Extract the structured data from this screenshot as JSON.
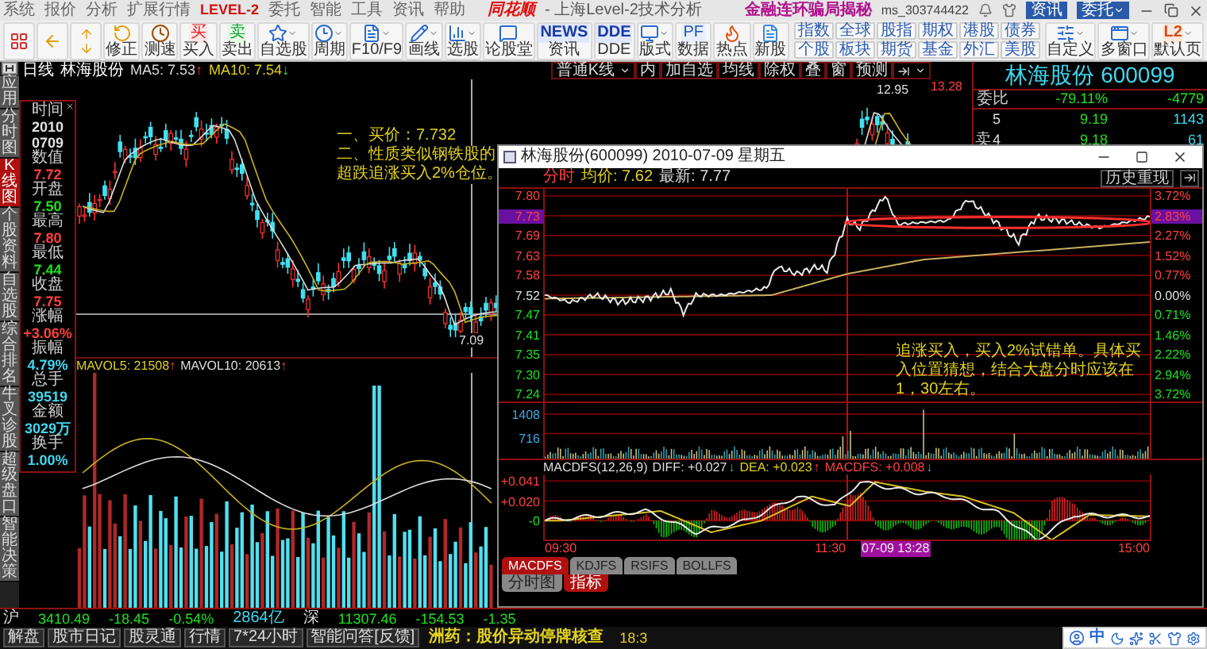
{
  "menu_bar": {
    "items": [
      {
        "label": "系统",
        "highlight": false
      },
      {
        "label": "报价",
        "highlight": false
      },
      {
        "label": "分析",
        "highlight": false
      },
      {
        "label": "扩展行情",
        "highlight": false
      },
      {
        "label": "LEVEL-2",
        "highlight": true
      },
      {
        "label": "委托",
        "highlight": false
      },
      {
        "label": "智能",
        "highlight": false
      },
      {
        "label": "工具",
        "highlight": false
      },
      {
        "label": "资讯",
        "highlight": false
      },
      {
        "label": "帮助",
        "highlight": false
      }
    ],
    "logo": "同花顺",
    "title": "- 上海Level-2技术分析",
    "promo": "金融连环骗局揭秘",
    "user": "ms_303744422",
    "buttons": [
      {
        "label": "资讯",
        "dropdown": false
      },
      {
        "label": "委托",
        "dropdown": true
      }
    ]
  },
  "toolbar": {
    "tools": [
      {
        "dropdown": false
      },
      {
        "dropdown": false
      },
      {
        "dropdown": false
      },
      {
        "label": "修正",
        "dropdown": false
      },
      {
        "label": "测速",
        "dropdown": false
      },
      {
        "label": "买入",
        "icon_text": "买",
        "dropdown": false
      },
      {
        "label": "卖出",
        "icon_text": "卖",
        "dropdown": false
      },
      {
        "label": "自选股",
        "dropdown": true
      },
      {
        "label": "周期",
        "dropdown": true
      },
      {
        "label": "F10/F9",
        "dropdown": true
      },
      {
        "label": "画线",
        "dropdown": true
      },
      {
        "label": "选股",
        "dropdown": true
      },
      {
        "label": "论股堂",
        "dropdown": false
      },
      {
        "label": "资讯",
        "icon_text": "NEWS",
        "dropdown": false
      },
      {
        "label": "DDE",
        "icon_text": "DDE",
        "dropdown": false
      },
      {
        "label": "版式",
        "dropdown": true
      },
      {
        "label": "数据",
        "icon_text": "PF",
        "dropdown": false
      },
      {
        "label": "热点",
        "dropdown": false
      },
      {
        "label": "新股",
        "dropdown": false
      }
    ],
    "market_buttons": [
      {
        "top": "指数",
        "bottom": "个股"
      },
      {
        "top": "全球",
        "bottom": "板块"
      },
      {
        "top": "股指",
        "bottom": "期货"
      },
      {
        "top": "期权",
        "bottom": "基金"
      },
      {
        "top": "港股",
        "bottom": "外汇"
      },
      {
        "top": "债券",
        "bottom": "美股"
      }
    ],
    "tools_right": [
      {
        "label": "自定义",
        "dropdown": true
      },
      {
        "label": "多窗口",
        "dropdown": true
      },
      {
        "label": "默认页",
        "icon_text": "L2",
        "dropdown": true
      }
    ]
  },
  "side_tabs": [
    {
      "label": "应用",
      "selected": false
    },
    {
      "label": "分时图",
      "selected": false
    },
    {
      "label": "K线图",
      "selected": true
    },
    {
      "label": "个股资料",
      "selected": false
    },
    {
      "label": "自选股",
      "selected": false
    },
    {
      "label": "综合排名",
      "selected": false
    },
    {
      "label": "牛叉诊股",
      "selected": false
    },
    {
      "label": "超级盘口",
      "selected": false
    },
    {
      "label": "智能决策",
      "selected": false
    }
  ],
  "kline": {
    "period": "日线",
    "stock": "林海股份",
    "ma5": {
      "label": "MA5: 7.53",
      "arrow": "↑"
    },
    "ma10": {
      "label": "MA10: 7.54",
      "arrow": "↓"
    },
    "low_label": "7.09",
    "high_label": "12.95",
    "max_label": "13.28",
    "annotation": [
      "一、买价：7.732",
      "二、性质类似钢铁股的",
      "超跌追涨买入2%仓位。"
    ]
  },
  "chart_toolbar": [
    {
      "label": "普通K线",
      "dropdown": true
    },
    {
      "label": "内",
      "dropdown": false
    },
    {
      "label": "加自选",
      "dropdown": false
    },
    {
      "label": "均线",
      "dropdown": false
    },
    {
      "label": "除权",
      "dropdown": false
    },
    {
      "label": "叠",
      "dropdown": false
    },
    {
      "label": "窗",
      "dropdown": false
    },
    {
      "label": "预测",
      "dropdown": false
    },
    {
      "dropdown": true
    }
  ],
  "info_box": [
    {
      "label": "时间",
      "values": [
        "2010",
        "0709"
      ],
      "kind": "plain"
    },
    {
      "label": "数值",
      "values": [
        "7.72"
      ],
      "kind": "up"
    },
    {
      "label": "开盘",
      "values": [
        "7.50"
      ],
      "kind": "down"
    },
    {
      "label": "最高",
      "values": [
        "7.80"
      ],
      "kind": "up"
    },
    {
      "label": "最低",
      "values": [
        "7.44"
      ],
      "kind": "down"
    },
    {
      "label": "收盘",
      "values": [
        "7.75"
      ],
      "kind": "up"
    },
    {
      "label": "涨幅",
      "values": [
        "+3.06%"
      ],
      "kind": "up"
    },
    {
      "label": "振幅",
      "values": [
        "4.79%"
      ],
      "kind": "info"
    },
    {
      "label": "总手",
      "values": [
        "39519"
      ],
      "kind": "info"
    },
    {
      "label": "金额",
      "values": [
        "3029万"
      ],
      "kind": "info"
    },
    {
      "label": "换手",
      "values": [
        "1.00%"
      ],
      "kind": "info"
    }
  ],
  "volume": {
    "mavol5": {
      "label": "MAVOL5: 21508",
      "arrow": "↑"
    },
    "mavol10": {
      "label": "MAVOL10: 20613",
      "arrow": "↑"
    }
  },
  "quote_panel": {
    "title": "林海股份 600099",
    "ratio": {
      "label": "委比",
      "percent": "-79.11%",
      "volume": "-4779"
    },
    "side_label": "卖",
    "rows": [
      {
        "rank": "5",
        "price": "9.19",
        "volume": "1143"
      },
      {
        "rank": "4",
        "price": "9.18",
        "volume": "61"
      }
    ]
  },
  "popup": {
    "title": "林海股份(600099) 2010-07-09 星期五",
    "mode": "分时",
    "avg": "均价: 7.62",
    "latest": "最新: 7.77",
    "replay_button": "历史重现",
    "price_scale": [
      {
        "price": "7.80",
        "percent": "3.72%",
        "kind": "up",
        "selected": false
      },
      {
        "price": "7.73",
        "percent": "2.83%",
        "kind": "up",
        "selected": true
      },
      {
        "price": "7.69",
        "percent": "2.27%",
        "kind": "up",
        "selected": false
      },
      {
        "price": "7.63",
        "percent": "1.52%",
        "kind": "up",
        "selected": false
      },
      {
        "price": "7.58",
        "percent": "0.77%",
        "kind": "up",
        "selected": false
      },
      {
        "price": "7.52",
        "percent": "0.00%",
        "kind": "plain",
        "selected": false
      },
      {
        "price": "7.47",
        "percent": "0.71%",
        "kind": "down",
        "selected": false
      },
      {
        "price": "7.41",
        "percent": "1.46%",
        "kind": "down",
        "selected": false
      },
      {
        "price": "7.35",
        "percent": "2.22%",
        "kind": "down",
        "selected": false
      },
      {
        "price": "7.30",
        "percent": "2.94%",
        "kind": "down",
        "selected": false
      },
      {
        "price": "7.24",
        "percent": "3.72%",
        "kind": "down",
        "selected": false
      }
    ],
    "volume_ticks": [
      "1408",
      "716"
    ],
    "macd": {
      "name": "MACDFS(12,26,9)",
      "diff": "DIFF: +0.027",
      "diff_arrow": "↓",
      "dea": "DEA: +0.023",
      "dea_arrow": "↑",
      "value": "MACDFS: +0.008",
      "value_arrow": "↓"
    },
    "macd_ticks": [
      {
        "label": "+0.041",
        "kind": "up"
      },
      {
        "label": "+0.020",
        "kind": "up"
      },
      {
        "label": "-0",
        "kind": "down"
      }
    ],
    "time_labels": [
      {
        "label": "09:30",
        "selected": false
      },
      {
        "label": "11:30",
        "selected": false
      },
      {
        "label": "07-09 13:28",
        "selected": true
      },
      {
        "label": "15:00",
        "selected": false
      }
    ],
    "annotation": "追涨买入，买入2%试错单。具体买入位置猜想，结合大盘分时应该在1，30左右。",
    "indicator_tabs": [
      {
        "label": "MACDFS",
        "selected": true
      },
      {
        "label": "KDJFS",
        "selected": false
      },
      {
        "label": "RSIFS",
        "selected": false
      },
      {
        "label": "BOLLFS",
        "selected": false
      }
    ],
    "view_tabs": [
      {
        "label": "分时图",
        "selected": false
      },
      {
        "label": "指标",
        "selected": true
      }
    ]
  },
  "status_bar": {
    "sh": {
      "label": "沪",
      "index": "3410.49",
      "change": "-18.45",
      "percent": "-0.54%",
      "amount": "2864亿"
    },
    "sz": {
      "label": "深",
      "index": "11307.46",
      "change": "-154.53",
      "percent": "-1.35"
    }
  },
  "news_bar": {
    "items": [
      "解盘",
      "股市日记",
      "股灵通",
      "行情",
      "7*24小时",
      "智能问答[反馈]"
    ],
    "headline": "洲药：股价异动停牌核查",
    "time": "18:3"
  },
  "ime_bar": {
    "label": "中"
  }
}
